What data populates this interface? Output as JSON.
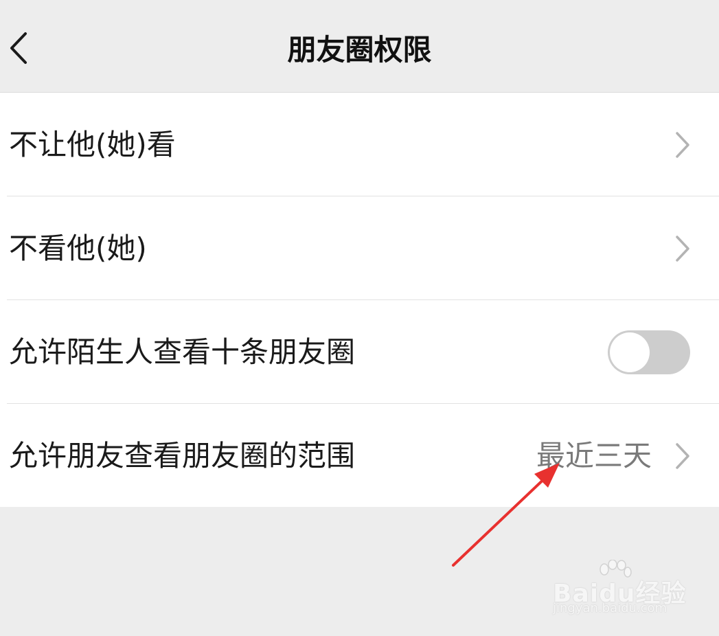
{
  "header": {
    "title": "朋友圈权限",
    "back_icon": "chevron-left-icon"
  },
  "rows": [
    {
      "label": "不让他(她)看",
      "control": "chevron"
    },
    {
      "label": "不看他(她)",
      "control": "chevron"
    },
    {
      "label": "允许陌生人查看十条朋友圈",
      "control": "toggle",
      "toggle_on": false
    },
    {
      "label": "允许朋友查看朋友圈的范围",
      "value": "最近三天",
      "control": "chevron"
    }
  ],
  "colors": {
    "background": "#ededed",
    "row_background": "#ffffff",
    "value_text": "#7a7a7a",
    "toggle_off": "#cdcdcd",
    "annotation_arrow": "#e8312f"
  },
  "watermark": {
    "brand": "Baidu经验",
    "url": "jingyan.baidu.com"
  }
}
